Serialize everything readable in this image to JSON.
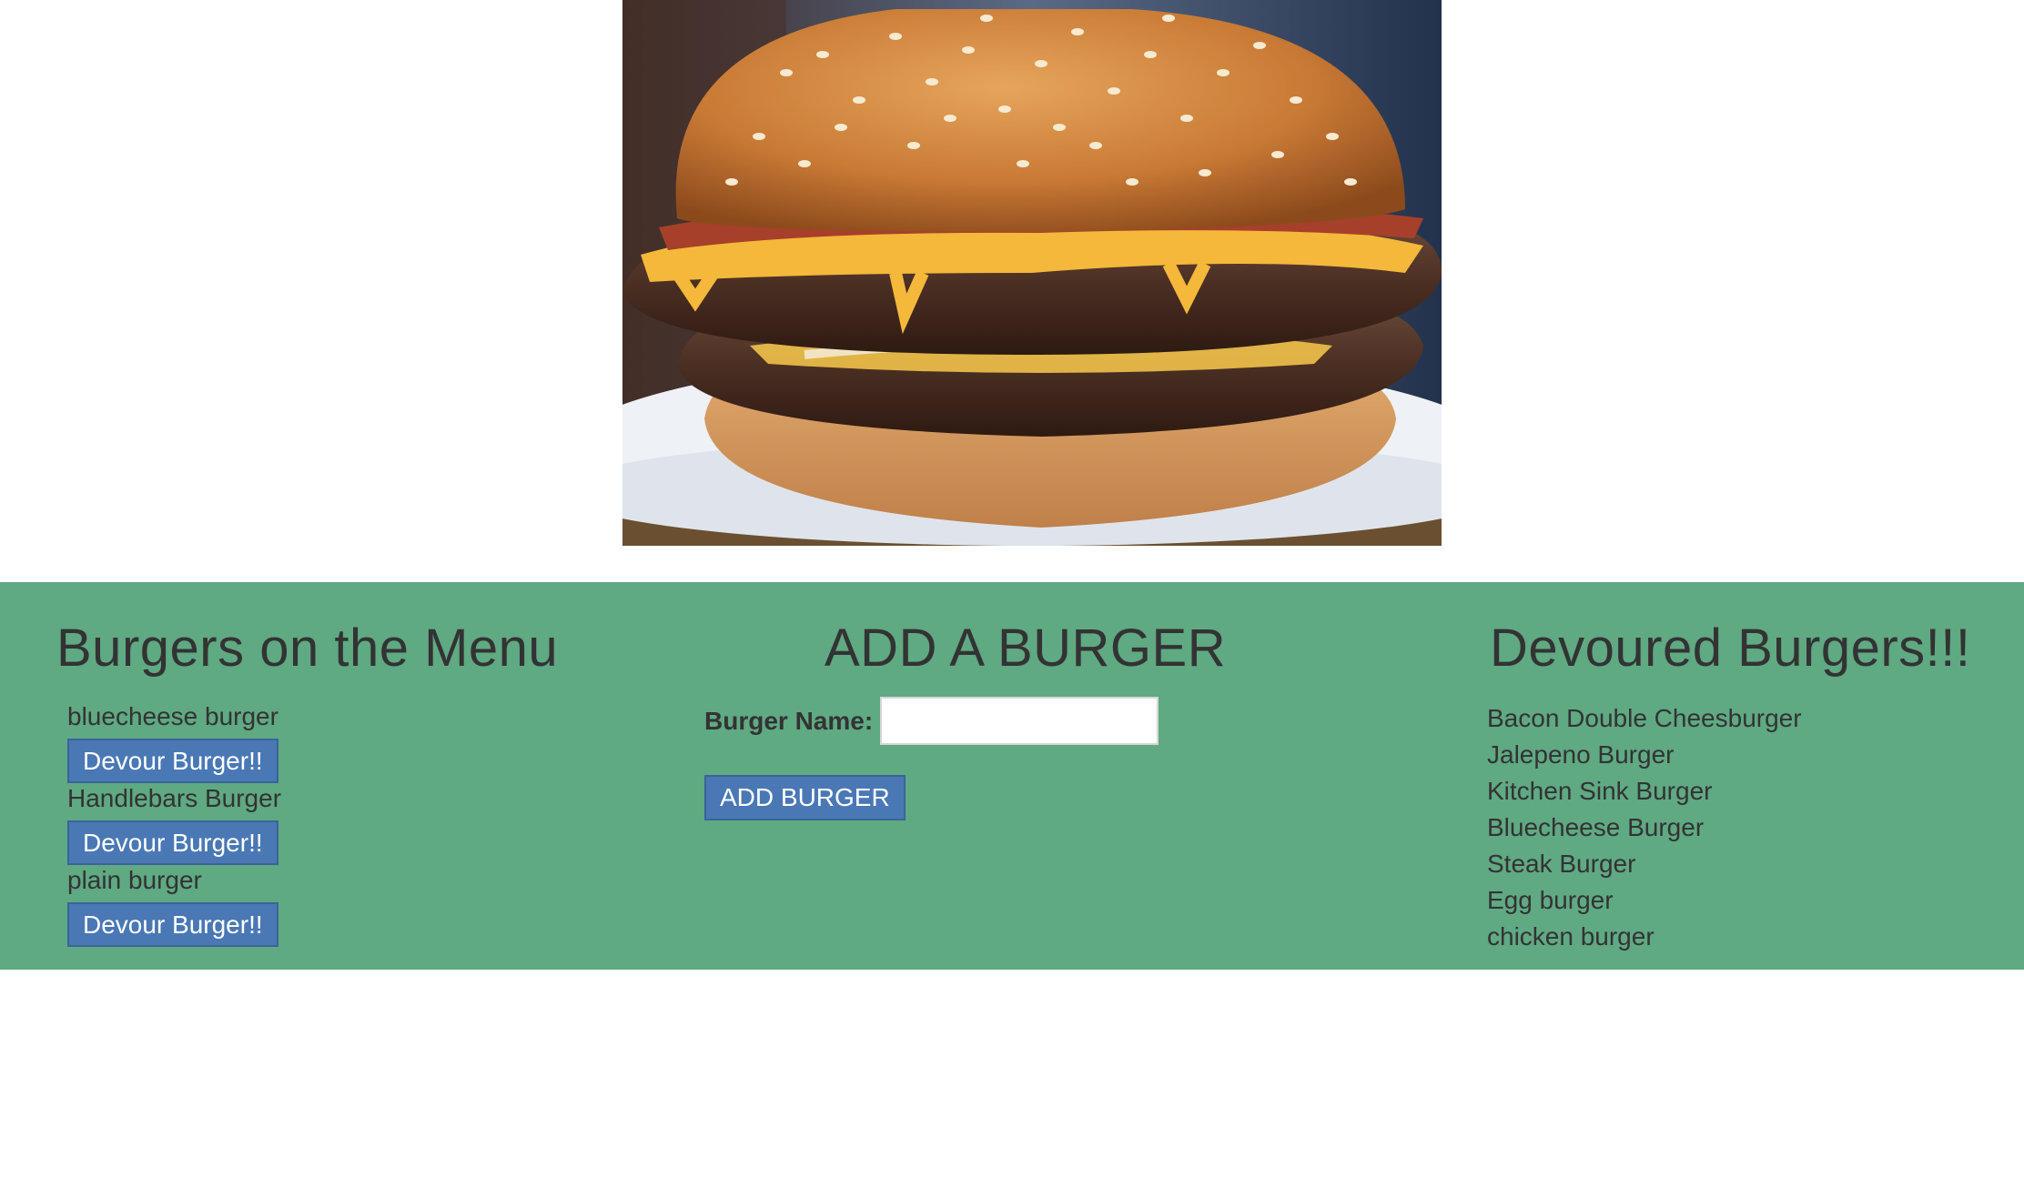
{
  "hero": {
    "image_name": "burger-photo"
  },
  "menu": {
    "title": "Burgers on the Menu",
    "items": [
      {
        "name": "bluecheese burger",
        "button_label": "Devour Burger!!"
      },
      {
        "name": "Handlebars Burger",
        "button_label": "Devour Burger!!"
      },
      {
        "name": "plain burger",
        "button_label": "Devour Burger!!"
      }
    ]
  },
  "add": {
    "title": "ADD A BURGER",
    "label": "Burger Name:",
    "input_value": "",
    "button_label": "ADD BURGER"
  },
  "devoured": {
    "title": "Devoured Burgers!!!",
    "items": [
      "Bacon Double Cheesburger",
      "Jalepeno Burger",
      "Kitchen Sink Burger",
      "Bluecheese Burger",
      "Steak Burger",
      "Egg burger",
      "chicken burger"
    ]
  },
  "colors": {
    "band": "#5fa983",
    "button": "#4a78b5",
    "text": "#333333"
  }
}
